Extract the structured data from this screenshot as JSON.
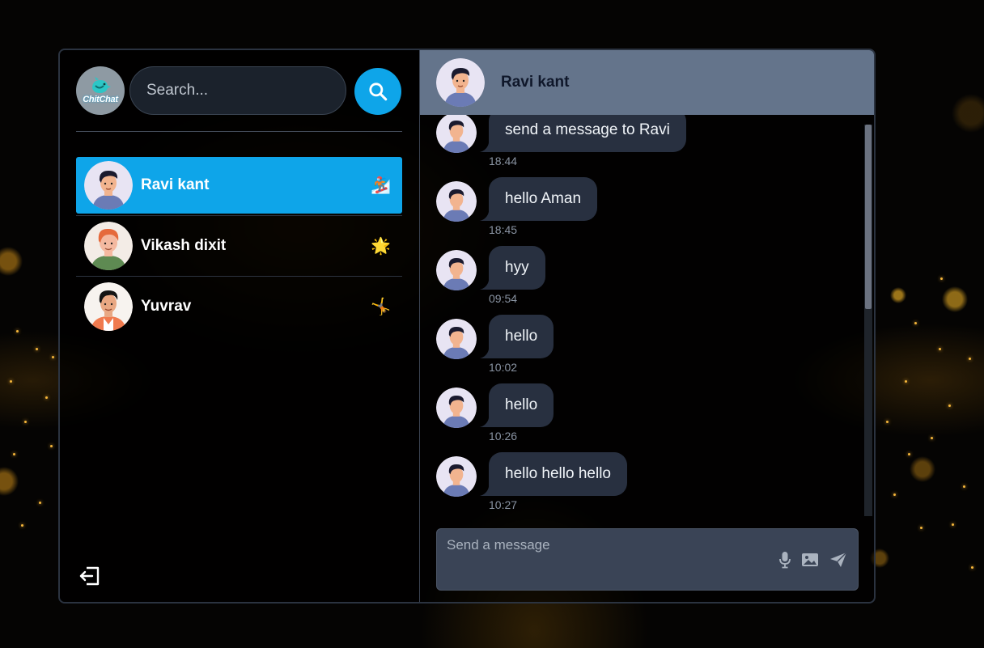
{
  "sidebar": {
    "logo_text": "ChitChat",
    "search": {
      "placeholder": "Search...",
      "value": ""
    },
    "chats": [
      {
        "name": "Ravi kant",
        "emoji": "🏂",
        "active": true
      },
      {
        "name": "Vikash dixit",
        "emoji": "🌟",
        "active": false
      },
      {
        "name": "Yuvrav",
        "emoji": "🤸",
        "active": false
      }
    ]
  },
  "header": {
    "name": "Ravi kant"
  },
  "messages": [
    {
      "text": "send a message to Ravi",
      "time": "18:44"
    },
    {
      "text": "hello Aman",
      "time": "18:45"
    },
    {
      "text": "hyy",
      "time": "09:54"
    },
    {
      "text": "hello",
      "time": "10:02"
    },
    {
      "text": "hello",
      "time": "10:26"
    },
    {
      "text": "hello hello hello",
      "time": "10:27"
    }
  ],
  "composer": {
    "placeholder": "Send a message",
    "value": ""
  },
  "colors": {
    "accent": "#0ea5e9",
    "header": "#64748b",
    "bubble": "#283040",
    "composer": "#3a4456"
  },
  "icons": [
    "search-icon",
    "logout-icon",
    "microphone-icon",
    "image-icon",
    "send-icon"
  ]
}
